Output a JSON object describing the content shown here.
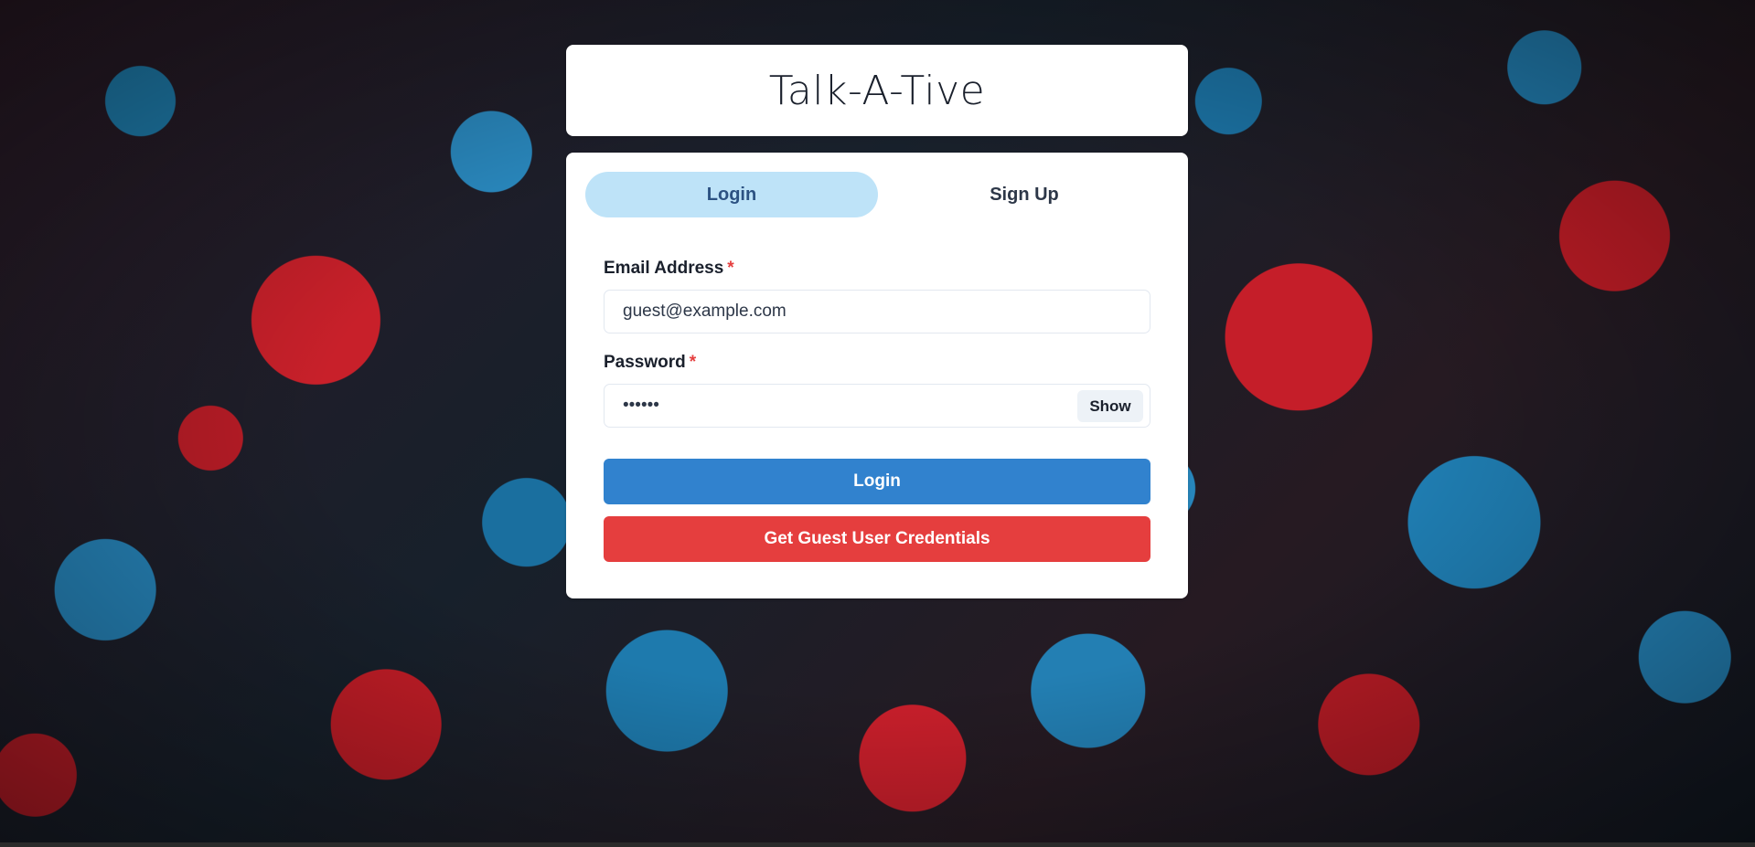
{
  "app": {
    "title": "Talk-A-Tive"
  },
  "tabs": [
    {
      "label": "Login",
      "active": true
    },
    {
      "label": "Sign Up",
      "active": false
    }
  ],
  "form": {
    "email_label": "Email Address",
    "email_value": "guest@example.com",
    "password_label": "Password",
    "password_value": "123456",
    "required_mark": "*",
    "show_label": "Show"
  },
  "buttons": {
    "login_label": "Login",
    "guest_label": "Get Guest User Credentials"
  },
  "colors": {
    "primary": "#3182ce",
    "danger": "#e53e3e",
    "active_tab_bg": "#bee3f8",
    "active_tab_text": "#2c5282"
  }
}
